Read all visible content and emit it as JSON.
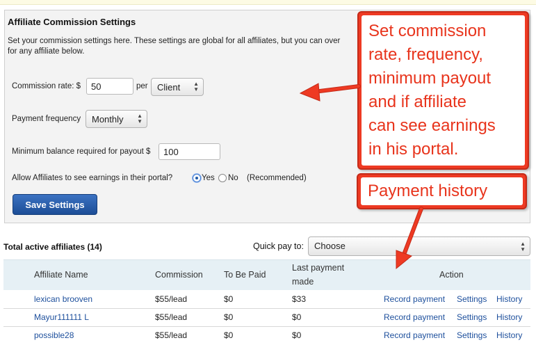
{
  "settings": {
    "title": "Affiliate Commission Settings",
    "description_line1": "Set your commission settings here. These settings are global for all affiliates, but you can over",
    "description_line2": "for any affiliate below.",
    "commission_rate_label": "Commission rate: $",
    "commission_rate_value": "50",
    "per_label": "per",
    "per_unit": "Client",
    "payment_frequency_label": "Payment frequency",
    "payment_frequency_value": "Monthly",
    "min_balance_label": "Minimum balance required for payout $",
    "min_balance_value": "100",
    "allow_earnings_label": "Allow Affiliates to see earnings in their portal?",
    "option_yes": "Yes",
    "option_no": "No",
    "allow_earnings_selected": "Yes",
    "recommended_note": "(Recommended)",
    "save_button": "Save Settings"
  },
  "affiliates": {
    "total_label": "Total active affiliates (14)",
    "quick_pay_label": "Quick pay to:",
    "quick_pay_value": "Choose",
    "columns": {
      "name": "Affiliate Name",
      "commission": "Commission",
      "to_be_paid": "To Be Paid",
      "last_payment_line1": "Last payment",
      "last_payment_line2": "made",
      "action": "Action"
    },
    "action_labels": {
      "record_payment": "Record payment",
      "settings": "Settings",
      "history": "History"
    },
    "rows": [
      {
        "name": "lexican brooven",
        "commission": "$55/lead",
        "to_be_paid": "$0",
        "last_payment": "$33"
      },
      {
        "name": "Mayur111111 L",
        "commission": "$55/lead",
        "to_be_paid": "$0",
        "last_payment": "$0"
      },
      {
        "name": "possible28",
        "commission": "$55/lead",
        "to_be_paid": "$0",
        "last_payment": "$0"
      }
    ]
  },
  "annotations": {
    "settings_callout": [
      "Set commission",
      "rate, frequency,",
      "minimum payout",
      "and if affiliate",
      "can see earnings",
      "in his portal."
    ],
    "history_callout": "Payment history",
    "accent_color": "#ee3a23"
  }
}
